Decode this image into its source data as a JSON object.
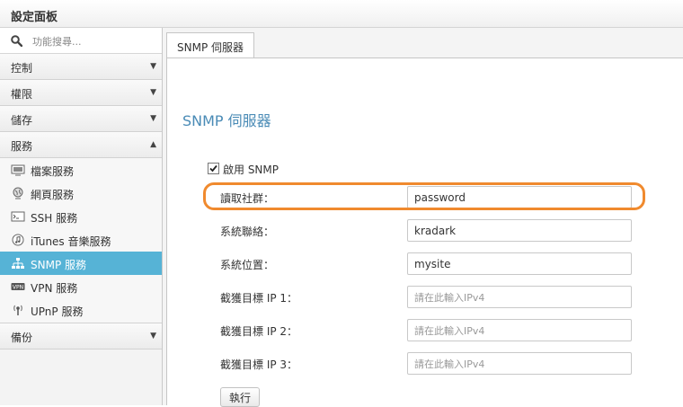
{
  "window": {
    "title": "設定面板"
  },
  "search": {
    "placeholder": "功能搜尋..."
  },
  "sidebar": {
    "categories": [
      {
        "label": "控制",
        "arrow": "▼"
      },
      {
        "label": "權限",
        "arrow": "▼"
      },
      {
        "label": "儲存",
        "arrow": "▼"
      },
      {
        "label": "服務",
        "arrow": "▲"
      },
      {
        "label": "備份",
        "arrow": "▼"
      }
    ],
    "services": [
      {
        "label": "檔案服務",
        "icon": "file-service-icon"
      },
      {
        "label": "網頁服務",
        "icon": "globe-icon"
      },
      {
        "label": "SSH 服務",
        "icon": "terminal-icon"
      },
      {
        "label": "iTunes 音樂服務",
        "icon": "music-icon"
      },
      {
        "label": "SNMP 服務",
        "icon": "network-icon",
        "active": true
      },
      {
        "label": "VPN 服務",
        "icon": "vpn-icon"
      },
      {
        "label": "UPnP 服務",
        "icon": "upnp-icon"
      }
    ]
  },
  "tabs": [
    {
      "label": "SNMP 伺服器"
    }
  ],
  "page": {
    "title": "SNMP 伺服器"
  },
  "form": {
    "enable": {
      "label": "啟用 SNMP",
      "checked": true
    },
    "fields": [
      {
        "label": "讀取社群：",
        "value": "password",
        "placeholder": ""
      },
      {
        "label": "系統聯絡：",
        "value": "kradark",
        "placeholder": ""
      },
      {
        "label": "系統位置：",
        "value": "mysite",
        "placeholder": ""
      },
      {
        "label": "截獲目標 IP 1：",
        "value": "",
        "placeholder": "請在此輸入IPv4"
      },
      {
        "label": "截獲目標 IP 2：",
        "value": "",
        "placeholder": "請在此輸入IPv4"
      },
      {
        "label": "截獲目標 IP 3：",
        "value": "",
        "placeholder": "請在此輸入IPv4"
      }
    ],
    "submit_label": "執行"
  },
  "colors": {
    "accent": "#56b3d6",
    "title": "#4a8bb6",
    "highlight": "#f08a2e"
  }
}
